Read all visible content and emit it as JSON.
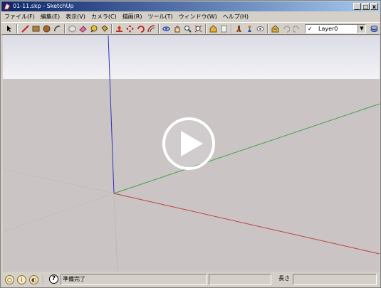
{
  "window": {
    "title": "01-11.skp - SketchUp",
    "buttons": {
      "minimize": "_",
      "maximize": "□",
      "close": "x"
    }
  },
  "menu": [
    "ファイル(F)",
    "編集(E)",
    "表示(V)",
    "カメラ(C)",
    "描画(R)",
    "ツール(T)",
    "ウィンドウ(W)",
    "ヘルプ(H)"
  ],
  "toolbar": {
    "layer_check": "✓",
    "layer_name": "Layer0",
    "layer_arrow": "▼"
  },
  "viewport": {
    "sky_color": "#e8e8ef",
    "ground_color": "#cac4c5",
    "axis_colors": {
      "red": "#c04040",
      "green": "#40a040",
      "blue": "#3030c0"
    },
    "play_icon": "play-circle-icon"
  },
  "status": {
    "message": "準備完了",
    "length_label": "長さ",
    "length_value": "",
    "help": "?"
  },
  "colors": {
    "title_start": "#0a246a",
    "title_end": "#a6caf0",
    "chrome": "#d4d0c8"
  }
}
